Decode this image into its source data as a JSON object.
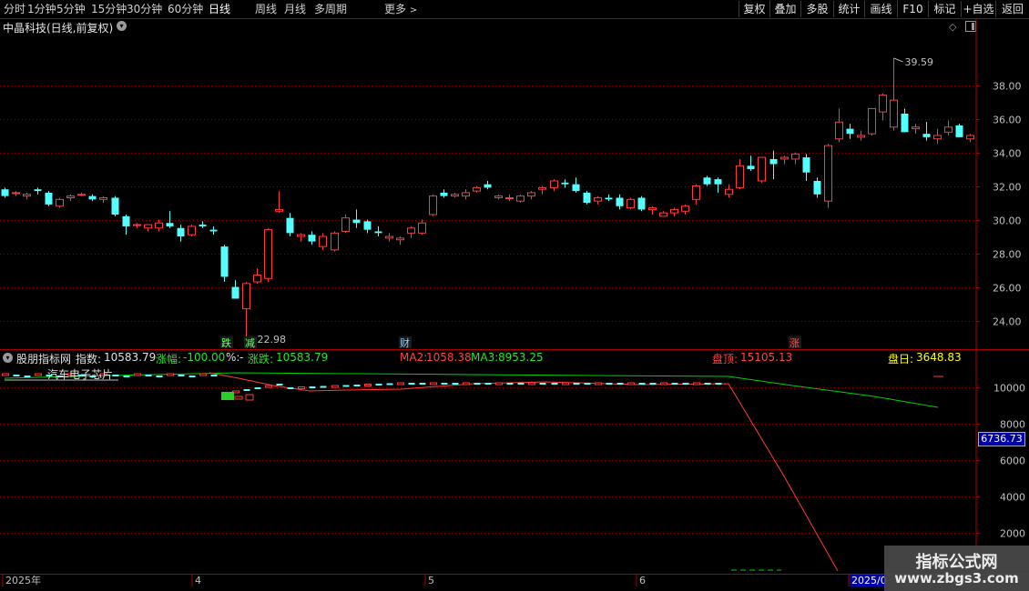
{
  "toolbar": {
    "timeframes": [
      "分时",
      "1分钟",
      "5分钟",
      "15分钟",
      "30分钟",
      "60分钟",
      "日线",
      "周线",
      "月线",
      "多周期"
    ],
    "active": "日线",
    "more_label": "更多",
    "more_arrow": ">",
    "right_buttons": [
      "复权",
      "叠加",
      "多股",
      "统计",
      "画线",
      "F10",
      "标记",
      "+自选",
      "返回"
    ]
  },
  "stock": {
    "title": "中晶科技(日线,前复权)",
    "drop_glyph": "▾"
  },
  "main_chart": {
    "y_ticks": [
      "38.00",
      "36.00",
      "34.00",
      "32.00",
      "30.00",
      "28.00",
      "26.00",
      "24.00"
    ],
    "high_label": "39.59",
    "low_label": "22.98",
    "markers": [
      {
        "text": "跌",
        "color": "#6bff6b"
      },
      {
        "text": "减",
        "color": "#6bff6b"
      },
      {
        "text": "财",
        "color": "#8fd0ff"
      },
      {
        "text": "涨",
        "color": "#ff5050"
      }
    ]
  },
  "indicator_bar": {
    "name": "股朋指标网",
    "index_label": "指数:",
    "index_value": "10583.79",
    "chg_label": "涨幅:",
    "chg_value": "-100.00",
    "pct_label": "%:",
    "pct_value": "-",
    "zd_label": "涨跌:",
    "zd_value": "10583.79",
    "ma2_label": "MA2:",
    "ma2_value": "1058.38",
    "ma3_label": "MA3:",
    "ma3_value": "8953.25",
    "top_label": "盘顶:",
    "top_value": "15105.13",
    "day_label": "盘日:",
    "day_value": "3648.83",
    "sector_label": "汽车电子芯片"
  },
  "sub_chart": {
    "y_ticks": [
      "10000",
      "8000",
      "6000",
      "4000",
      "2000"
    ],
    "current_value": "6736.73"
  },
  "time_axis": {
    "labels": [
      "2025年",
      "4",
      "5",
      "6",
      "2025/0"
    ]
  },
  "watermark": {
    "line1": "指标公式网",
    "line2": "www.zbgs3.com"
  },
  "colors": {
    "up": "#ff3b3b",
    "down": "#54ffff",
    "grid": "#8b0000",
    "ma_green": "#00d000"
  },
  "chart_data": {
    "type": "candlestick",
    "title": "中晶科技(日线,前复权)",
    "ylim": [
      22.3,
      41.0
    ],
    "ohlc": [
      [
        31.8,
        31.9,
        31.3,
        31.4
      ],
      [
        31.6,
        31.7,
        31.4,
        31.6
      ],
      [
        31.4,
        31.6,
        31.2,
        31.5
      ],
      [
        31.8,
        31.9,
        31.5,
        31.7
      ],
      [
        31.6,
        31.7,
        30.8,
        30.9
      ],
      [
        30.8,
        31.3,
        30.7,
        31.2
      ],
      [
        31.3,
        31.5,
        31.1,
        31.4
      ],
      [
        31.5,
        31.6,
        31.4,
        31.5
      ],
      [
        31.4,
        31.5,
        31.1,
        31.2
      ],
      [
        31.2,
        31.4,
        31.0,
        31.3
      ],
      [
        31.3,
        31.4,
        30.2,
        30.3
      ],
      [
        30.2,
        30.3,
        29.1,
        29.6
      ],
      [
        29.7,
        29.8,
        29.5,
        29.7
      ],
      [
        29.5,
        29.7,
        29.3,
        29.7
      ],
      [
        29.5,
        30.0,
        29.3,
        29.8
      ],
      [
        29.8,
        30.5,
        29.5,
        29.6
      ],
      [
        29.5,
        29.7,
        28.7,
        29.0
      ],
      [
        29.1,
        29.7,
        29.0,
        29.6
      ],
      [
        29.7,
        29.9,
        29.5,
        29.6
      ],
      [
        29.4,
        29.6,
        29.1,
        29.3
      ],
      [
        28.4,
        28.5,
        26.3,
        26.6
      ],
      [
        26.0,
        26.4,
        25.3,
        25.3
      ],
      [
        24.7,
        26.3,
        23.0,
        26.2
      ],
      [
        26.3,
        27.1,
        26.2,
        26.7
      ],
      [
        26.5,
        29.5,
        26.3,
        29.4
      ],
      [
        30.5,
        31.7,
        30.4,
        30.6
      ],
      [
        30.1,
        30.4,
        29.0,
        29.2
      ],
      [
        29.0,
        29.2,
        28.7,
        29.1
      ],
      [
        29.1,
        29.3,
        28.5,
        28.7
      ],
      [
        28.4,
        29.2,
        28.2,
        29.0
      ],
      [
        28.2,
        29.3,
        28.1,
        29.2
      ],
      [
        29.3,
        30.3,
        29.2,
        30.1
      ],
      [
        30.0,
        30.6,
        29.5,
        29.8
      ],
      [
        29.9,
        30.0,
        29.2,
        29.4
      ],
      [
        29.3,
        29.6,
        29.0,
        29.2
      ],
      [
        28.9,
        29.2,
        28.7,
        29.0
      ],
      [
        28.8,
        29.0,
        28.5,
        28.9
      ],
      [
        29.2,
        29.6,
        28.9,
        29.5
      ],
      [
        29.2,
        30.0,
        29.1,
        29.8
      ],
      [
        30.3,
        31.5,
        30.2,
        31.4
      ],
      [
        31.6,
        31.8,
        31.3,
        31.4
      ],
      [
        31.4,
        31.6,
        31.3,
        31.5
      ],
      [
        31.4,
        31.8,
        31.2,
        31.6
      ],
      [
        31.7,
        32.0,
        31.6,
        31.9
      ],
      [
        32.1,
        32.3,
        31.8,
        31.9
      ],
      [
        31.3,
        31.5,
        31.2,
        31.4
      ],
      [
        31.3,
        31.5,
        31.1,
        31.3
      ],
      [
        31.1,
        31.5,
        31.0,
        31.4
      ],
      [
        31.4,
        31.7,
        31.2,
        31.6
      ],
      [
        31.8,
        32.0,
        31.5,
        31.9
      ],
      [
        31.9,
        32.4,
        31.7,
        32.3
      ],
      [
        32.2,
        32.4,
        31.9,
        32.1
      ],
      [
        32.1,
        32.5,
        31.6,
        31.7
      ],
      [
        31.6,
        31.7,
        30.9,
        31.0
      ],
      [
        31.1,
        31.4,
        30.9,
        31.3
      ],
      [
        31.3,
        31.5,
        31.1,
        31.2
      ],
      [
        31.3,
        31.5,
        30.6,
        30.8
      ],
      [
        30.7,
        31.3,
        30.6,
        31.2
      ],
      [
        31.3,
        31.4,
        30.5,
        30.6
      ],
      [
        30.6,
        30.8,
        30.3,
        30.7
      ],
      [
        30.2,
        30.5,
        30.2,
        30.4
      ],
      [
        30.4,
        30.7,
        30.2,
        30.6
      ],
      [
        30.5,
        30.9,
        30.3,
        30.8
      ],
      [
        31.2,
        32.1,
        30.9,
        32.0
      ],
      [
        32.5,
        32.6,
        32.0,
        32.1
      ],
      [
        32.4,
        32.5,
        31.6,
        32.1
      ],
      [
        31.5,
        32.1,
        31.3,
        31.8
      ],
      [
        31.9,
        33.6,
        31.8,
        33.2
      ],
      [
        33.2,
        33.8,
        32.9,
        33.0
      ],
      [
        32.3,
        33.7,
        32.2,
        33.7
      ],
      [
        33.6,
        34.1,
        32.4,
        33.3
      ],
      [
        33.6,
        33.8,
        33.3,
        33.7
      ],
      [
        33.6,
        34.0,
        33.3,
        33.9
      ],
      [
        33.7,
        33.9,
        32.3,
        32.8
      ],
      [
        32.3,
        32.5,
        31.3,
        31.5
      ],
      [
        31.1,
        34.5,
        30.7,
        34.4
      ],
      [
        34.8,
        36.6,
        34.6,
        35.8
      ],
      [
        35.4,
        35.7,
        34.8,
        35.1
      ],
      [
        34.9,
        35.3,
        34.7,
        35.0
      ],
      [
        35.1,
        36.6,
        35.0,
        36.6
      ],
      [
        36.4,
        37.5,
        35.9,
        37.4
      ],
      [
        35.5,
        39.6,
        35.3,
        37.1
      ],
      [
        36.3,
        36.6,
        35.2,
        35.2
      ],
      [
        35.4,
        35.7,
        35.1,
        35.5
      ],
      [
        35.1,
        35.8,
        34.7,
        34.9
      ],
      [
        34.8,
        35.4,
        34.5,
        35.0
      ],
      [
        35.2,
        35.9,
        35.0,
        35.5
      ],
      [
        35.6,
        35.7,
        34.9,
        34.9
      ],
      [
        34.8,
        35.1,
        34.6,
        35.0
      ]
    ]
  }
}
